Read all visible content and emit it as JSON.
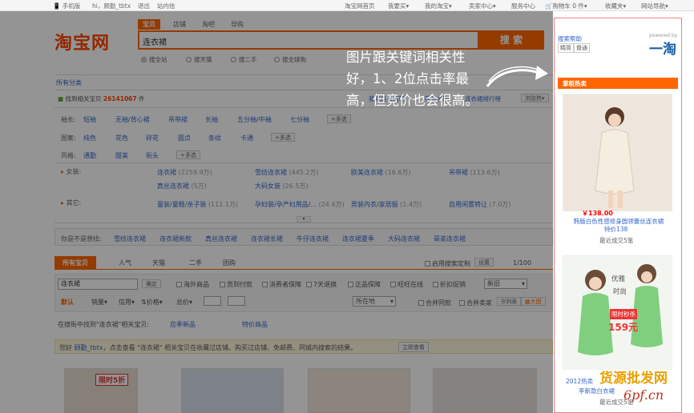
{
  "topbar": {
    "mobile": "手机版",
    "greeting": "hi，顾勤_tbtx",
    "logout": "退出",
    "messages": "站内信",
    "home": "淘宝网首页",
    "buy": "我要买",
    "my_taobao": "我的淘宝",
    "seller": "卖家中心",
    "service": "服务中心",
    "cart": "购物车 0 件",
    "favorites": "收藏夹",
    "nav": "网站导航"
  },
  "logo": "淘宝网",
  "search": {
    "tabs": [
      "宝贝",
      "店铺",
      "淘吧",
      "导购"
    ],
    "query": "连衣裙",
    "button": "搜 索",
    "scopes": [
      "搜全站",
      "搜天猫",
      "搜二手",
      "搜全球购"
    ]
  },
  "filters": {
    "all_categories": "所有分类",
    "found_prefix": "找到相关宝贝",
    "found_count": "26141067",
    "found_suffix": "件",
    "hot_label": "我来连衣裙吧",
    "want": "我来求购",
    "rank": "连衣裙排行榜",
    "browse": "浏览热",
    "sleeve_label": "袖长:",
    "sleeve": [
      "短袖",
      "无袖/背心裙",
      "吊带裙",
      "长袖",
      "五分袖/中袖",
      "七分袖"
    ],
    "pattern_label": "图案:",
    "pattern": [
      "纯色",
      "花色",
      "碎花",
      "圆点",
      "条纹",
      "卡通"
    ],
    "style_label": "风格:",
    "style": [
      "通勤",
      "甜美",
      "街头"
    ],
    "more": "+多选",
    "women_label": "女装:",
    "women": [
      {
        "name": "连衣裙",
        "count": "(2259.9万)"
      },
      {
        "name": "雪纺连衣裙",
        "count": "(445.2万)"
      },
      {
        "name": "欧美连衣裙",
        "count": "(16.6万)"
      },
      {
        "name": "吊带裙",
        "count": "(113.6万)"
      },
      {
        "name": "真丝连衣裙",
        "count": "(5万)"
      },
      {
        "name": "大码女装",
        "count": "(26.5万)"
      }
    ],
    "other_label": "其它:",
    "other": [
      {
        "name": "童装/童鞋/亲子装",
        "count": "(111.1万)"
      },
      {
        "name": "孕妇装/孕产妇用品/...",
        "count": "(24.4万)"
      },
      {
        "name": "男装内衣/家居服",
        "count": "(1.4万)"
      },
      {
        "name": "自用闲置转让",
        "count": "(7.0万)"
      }
    ],
    "suggest_label": "你是不是想找:",
    "suggest": [
      "雪纺连衣裙",
      "连衣裙新款",
      "真丝连衣裙",
      "连衣裙长裙",
      "牛仔连衣裙",
      "连衣裙夏季",
      "大码连衣裙",
      "哥弟连衣裙"
    ]
  },
  "results": {
    "tabs": [
      "所有宝贝",
      "人气",
      "天猫",
      "二手",
      "团购"
    ],
    "use_prev": "启用搜索定制",
    "settings": "设置",
    "page": "1/100",
    "within_query": "连衣裙",
    "confirm": "确定",
    "checks": [
      "海外商品",
      "货到付款",
      "消费者保障",
      "7天退换",
      "正品保障",
      "旺旺在线",
      "折扣促销"
    ],
    "sort_select": "新旧",
    "sort": [
      "默认",
      "销量",
      "信用",
      "价格",
      "总价"
    ],
    "location": "所在地",
    "merge": [
      "合并同款",
      "合并卖家"
    ],
    "view": [
      "列表",
      "大图"
    ],
    "related_text": "在搜街中找到\"连衣裙\"相关宝贝:",
    "related_links": [
      "应季新品",
      "特价商品"
    ],
    "notice_prefix": "您好",
    "notice_user": "顾勤_tbtx",
    "notice_body": "点击查看 \"连衣裙\" 相关宝贝在收藏过店铺、购买过店铺、免邮费、同城内搜索的结果。",
    "notice_btn": "立即查看"
  },
  "overlay": {
    "callout": "图片跟关键词相关性好，1、2位点击率最高，但竞价也会很高。"
  },
  "sidebar": {
    "powered": "powered by",
    "help": "搜索帮助",
    "mode1": "精简",
    "mode2": "普通",
    "brand": "一淘",
    "hot_title": "掌柜热卖",
    "ad1": {
      "price": "￥138.00",
      "title": "韩版白色性感修身圆领蕾丝连衣裙",
      "special": "特价138",
      "sold": "最近成交5笔"
    },
    "ad2": {
      "tag1": "优雅",
      "tag2": "时尚",
      "promo": "限时秒杀",
      "promo_price": "159元",
      "title": "2012热卖",
      "subtitle": "李新款白衣裙",
      "sold": "最近成交5笔"
    }
  },
  "thumbs": {
    "t1_badge": "限时5折"
  },
  "watermark": {
    "brand": "货源批发网",
    "url": "6pf.cn"
  },
  "colors": {
    "accent": "#ff6600",
    "link": "#3366cc",
    "price": "#ff0000"
  }
}
